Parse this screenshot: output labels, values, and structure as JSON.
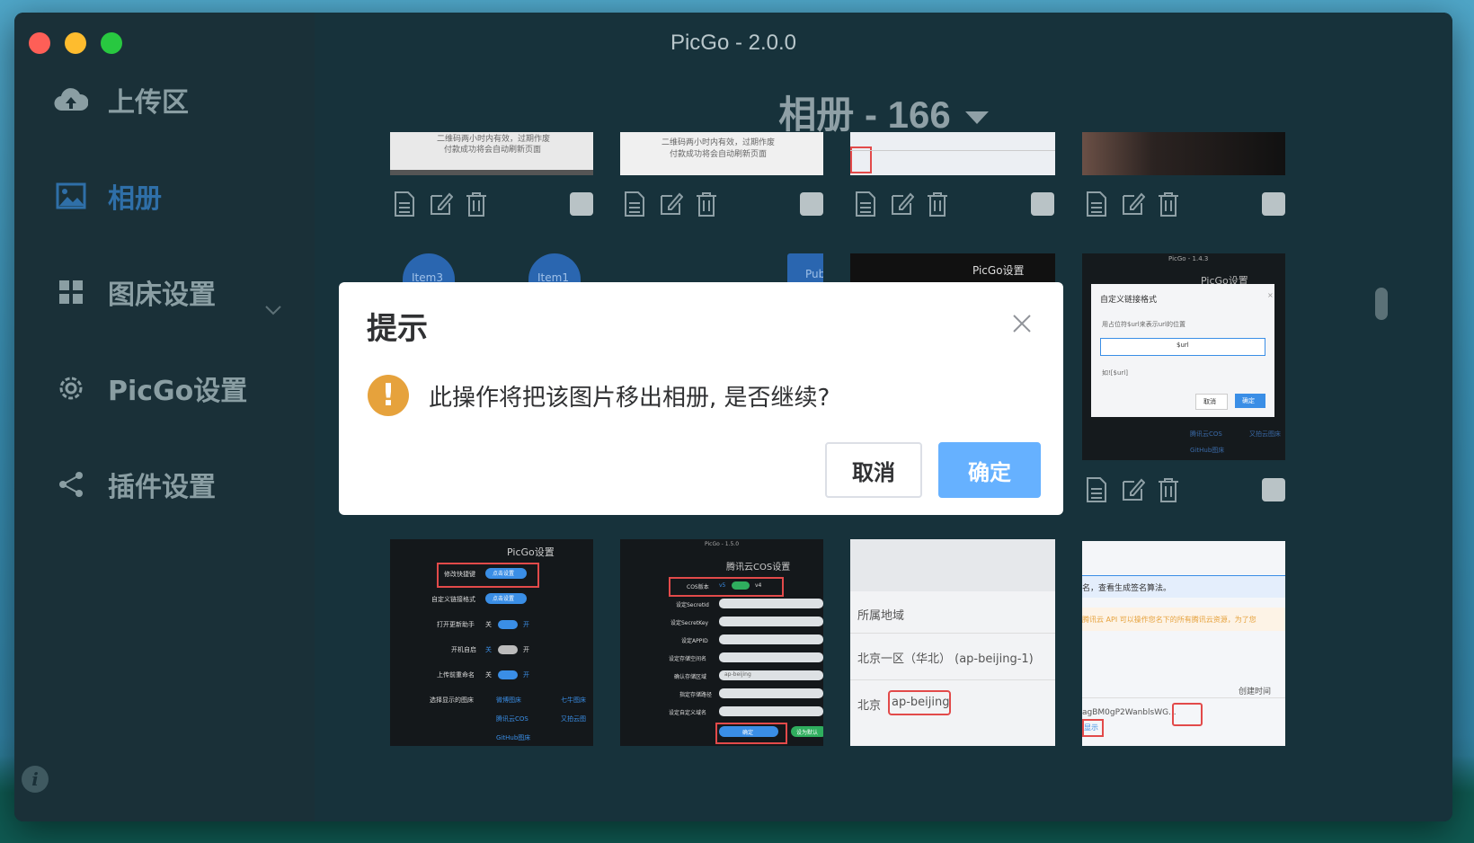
{
  "window": {
    "title": "PicGo - 2.0.0"
  },
  "sidebar": {
    "items": [
      {
        "label": "上传区",
        "icon": "cloud-upload-icon"
      },
      {
        "label": "相册",
        "icon": "image-icon",
        "active": true
      },
      {
        "label": "图床设置",
        "icon": "grid-icon"
      },
      {
        "label": "PicGo设置",
        "icon": "gear-icon"
      },
      {
        "label": "插件设置",
        "icon": "share-icon"
      }
    ],
    "info_glyph": "i"
  },
  "album": {
    "title": "相册 - 166"
  },
  "thumbnails": {
    "t1_line1": "二维码两小时内有效，过期作废",
    "t1_line2": "付款成功将会自动刷新页面",
    "t2_line1": "二维码两小时内有效，过期作废",
    "t2_line2": "付款成功将会自动刷新页面",
    "item3": "Item3",
    "item1": "Item1",
    "pub": "Pub",
    "picgo_settings": "PicGo设置",
    "t8_version": "PicGo - 1.4.3",
    "t8_title": "PicGo设置",
    "t8_dialog_title": "自定义链接格式",
    "t8_dialog_hint": "用占位符$url来表示url的位置",
    "t8_input": "$url",
    "t8_example": "如![$url]",
    "t8_cancel": "取消",
    "t8_ok": "确定",
    "t8_cos": "腾讯云COS",
    "t8_github": "GitHub图床",
    "t8_youpai": "又拍云图床",
    "t9_title": "PicGo设置",
    "t9_rows": [
      "修改快捷键",
      "自定义链接格式",
      "打开更新助手",
      "开机自启",
      "上传前重命名",
      "选择显示的图床"
    ],
    "t9_btn": "点击设置",
    "t9_off": "关",
    "t9_on": "开",
    "t9_beds": [
      "微博图床",
      "七牛图床",
      "腾讯云COS",
      "又拍云图",
      "GitHub图床"
    ],
    "t10_version": "PicGo - 1.5.0",
    "t10_title": "腾讯云COS设置",
    "t10_rows": [
      "COS版本",
      "设定SecretId",
      "设定SecretKey",
      "设定APPID",
      "设定存储空间名",
      "确认存储区域",
      "指定存储路径",
      "设定自定义域名"
    ],
    "t10_v5": "v5",
    "t10_v4": "v4",
    "t10_region": "ap-beijing",
    "t10_ok": "确定",
    "t10_default": "设为默认",
    "t11_header": "所属地域",
    "t11_row1": "北京一区（华北） (ap-beijing-1)",
    "t11_row2_a": "北京",
    "t11_row2_b": "ap-beijing",
    "t12_line1": "名，查看生成签名算法。",
    "t12_line2": "腾讯云 API 可以操作您名下的所有腾讯云资源，为了您",
    "t12_col": "创建时间",
    "t12_key": "agBM0gP2WanblsWG...",
    "t12_show": "显示"
  },
  "dialog": {
    "title": "提示",
    "message": "此操作将把该图片移出相册, 是否继续?",
    "cancel_label": "取消",
    "confirm_label": "确定",
    "warning_glyph": "!"
  },
  "colors": {
    "sidebar_bg": "#1a3038",
    "main_bg": "#17323b",
    "active": "#2f6fa8",
    "confirm_button": "#66b1ff",
    "warning": "#e6a23c"
  }
}
